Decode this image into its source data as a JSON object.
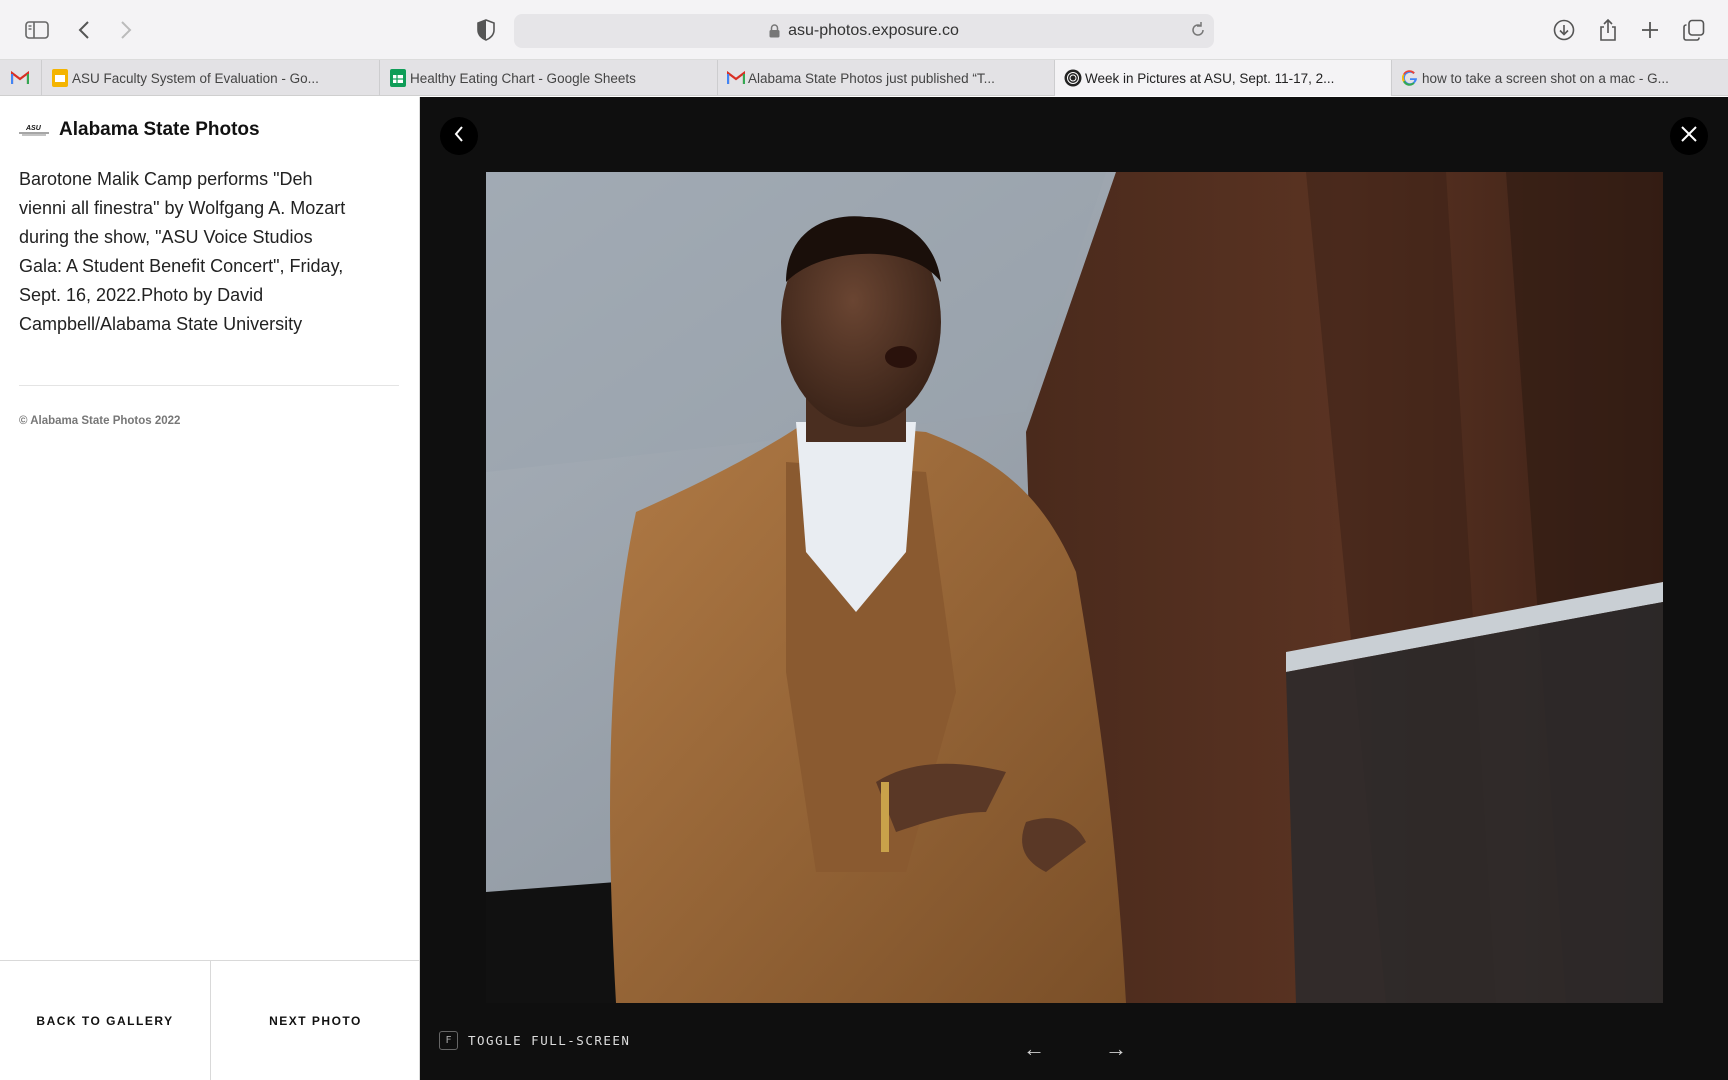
{
  "browser": {
    "url": "asu-photos.exposure.co",
    "tabs": [
      {
        "title": "",
        "favicon": "gmail-icon",
        "pinned": true
      },
      {
        "title": "ASU Faculty System of Evaluation - Go...",
        "favicon": "google-slides-icon"
      },
      {
        "title": "Healthy Eating Chart - Google Sheets",
        "favicon": "google-sheets-icon"
      },
      {
        "title": "Alabama State Photos just published “T...",
        "favicon": "gmail-icon"
      },
      {
        "title": "Week in Pictures at ASU, Sept. 11-17, 2...",
        "favicon": "exposure-icon",
        "active": true
      },
      {
        "title": "how to take a screen shot on a mac - G...",
        "favicon": "google-icon"
      }
    ]
  },
  "panel": {
    "site_name": "Alabama State Photos",
    "caption": "Barotone Malik Camp performs \"Deh vienni all finestra\" by Wolfgang A. Mozart during the show, \"ASU Voice Studios Gala: A Student Benefit Concert\", Friday, Sept. 16, 2022.Photo by David Campbell/Alabama State University",
    "copyright": "© Alabama State Photos 2022",
    "back_label": "BACK TO GALLERY",
    "next_label": "NEXT PHOTO"
  },
  "viewer": {
    "toggle_key": "F",
    "toggle_label": "TOGGLE FULL-SCREEN",
    "prev_arrow": "←",
    "next_arrow": "→"
  },
  "colors": {
    "viewer_bg": "#0f0f0f",
    "panel_bg": "#ffffff",
    "toolbar_bg": "#f4f3f5"
  }
}
